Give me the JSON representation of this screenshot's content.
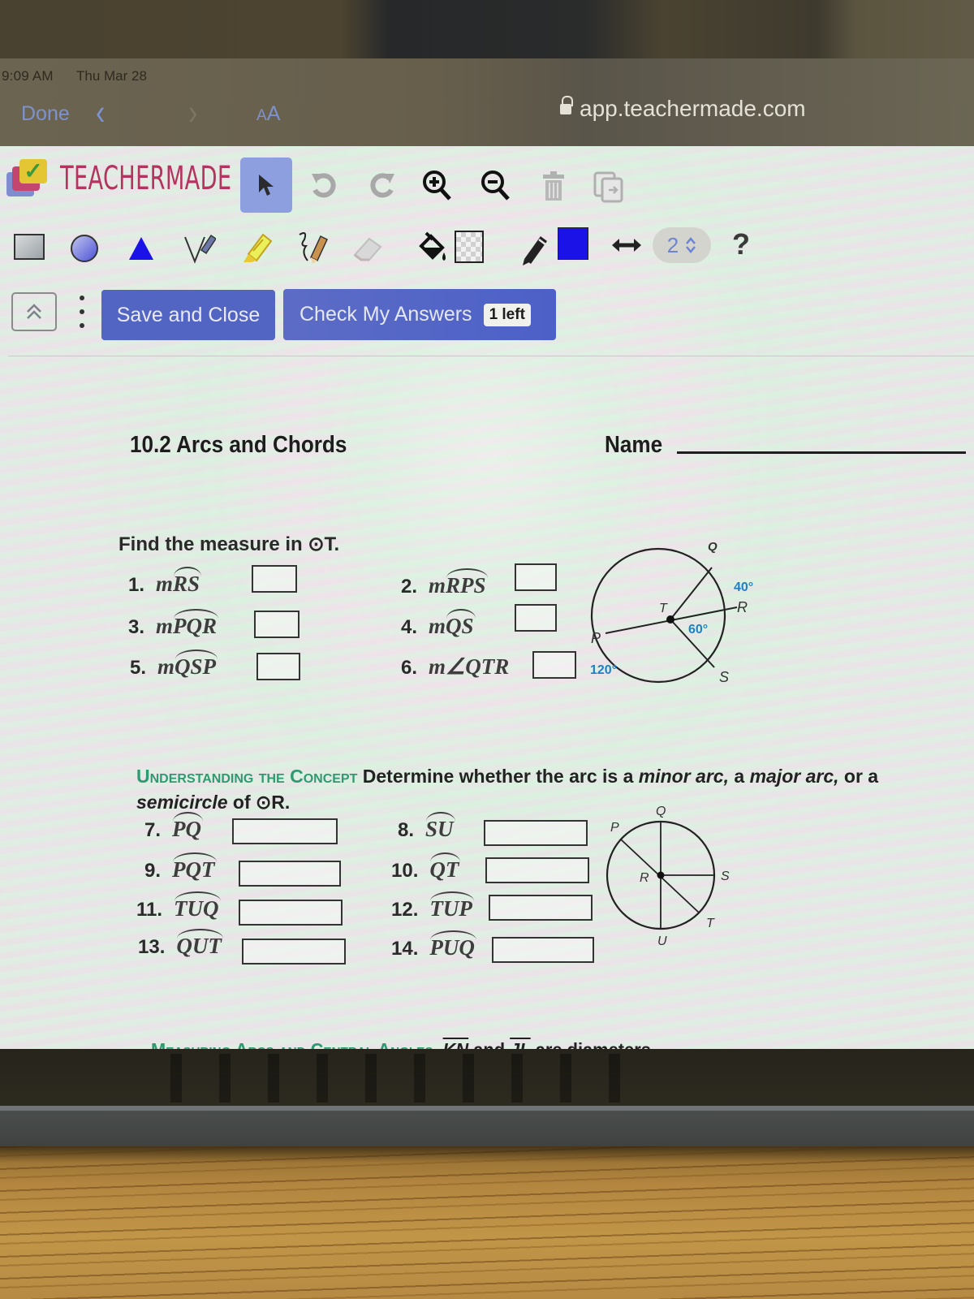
{
  "status_bar": {
    "time": "9:09 AM",
    "date": "Thu Mar 28"
  },
  "browser": {
    "done_label": "Done",
    "back_icon": "chevron-left-icon",
    "forward_icon": "chevron-right-icon",
    "reader_label_small": "A",
    "reader_label_large": "A",
    "url": "app.teachermade.com"
  },
  "app": {
    "logo_text": "TEACHERMADE",
    "toolbar_row1": [
      "select-arrow-icon",
      "undo-icon",
      "redo-icon",
      "zoom-in-icon",
      "zoom-out-icon",
      "trash-icon",
      "copy-icon"
    ],
    "toolbar_row2": [
      "rectangle-icon",
      "circle-icon",
      "triangle-icon",
      "pen-icon",
      "highlighter-icon",
      "handwriting-icon",
      "eraser-icon",
      "fill-bucket-icon",
      "fill-color-swatch",
      "pencil-icon",
      "stroke-color-swatch",
      "line-width-icon"
    ],
    "stroke_width": "2",
    "help_label": "?",
    "fill_color": "#dcdcdc",
    "stroke_color": "#1a12e6",
    "accent_color": "#5265c2",
    "save_close_label": "Save and Close",
    "check_answers_label": "Check My Answers",
    "checks_left_label": "1 left"
  },
  "worksheet": {
    "title": "10.2 Arcs and Chords",
    "name_label": "Name",
    "section1": {
      "heading": "Find the measure in ⊙T.",
      "questions": [
        {
          "num": "1.",
          "prefix": "m",
          "arc": "RS",
          "answer": ""
        },
        {
          "num": "2.",
          "prefix": "m",
          "arc": "RPS",
          "answer": ""
        },
        {
          "num": "3.",
          "prefix": "m",
          "arc": "PQR",
          "answer": ""
        },
        {
          "num": "4.",
          "prefix": "m",
          "arc": "QS",
          "answer": ""
        },
        {
          "num": "5.",
          "prefix": "m",
          "arc": "QSP",
          "answer": ""
        },
        {
          "num": "6.",
          "prefix": "m∠",
          "text": "QTR",
          "answer": ""
        }
      ],
      "diagram": {
        "center": "T",
        "points": [
          "Q",
          "R",
          "S",
          "P"
        ],
        "angle_labels": [
          "40°",
          "60°",
          "120°"
        ]
      }
    },
    "section2": {
      "heading_caps": "Understanding the Concept",
      "instruction_pre": "Determine whether the arc is a ",
      "minor": "minor arc,",
      "mid1": " a ",
      "major": "major arc,",
      "mid2": " or a ",
      "semi": "semicircle",
      "post": " of ⊙R.",
      "questions": [
        {
          "num": "7.",
          "arc": "PQ",
          "answer": ""
        },
        {
          "num": "8.",
          "arc": "SU",
          "answer": ""
        },
        {
          "num": "9.",
          "arc": "PQT",
          "answer": ""
        },
        {
          "num": "10.",
          "arc": "QT",
          "answer": ""
        },
        {
          "num": "11.",
          "arc": "TUQ",
          "answer": ""
        },
        {
          "num": "12.",
          "arc": "TUP",
          "answer": ""
        },
        {
          "num": "13.",
          "arc": "QUT",
          "answer": ""
        },
        {
          "num": "14.",
          "arc": "PUQ",
          "answer": ""
        }
      ],
      "diagram": {
        "center": "R",
        "points": [
          "Q",
          "P",
          "S",
          "T",
          "U"
        ]
      }
    },
    "section3": {
      "heading_caps": "Measuring Arcs and Central Angles",
      "seg1": "KN",
      "and": " and ",
      "seg2": "JL",
      "post": " are diameters."
    }
  }
}
